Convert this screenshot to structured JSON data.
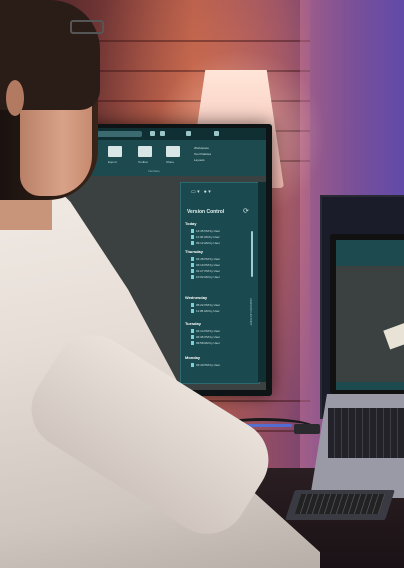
{
  "scene": {
    "description_tag": "photo-of-developer-at-desk"
  },
  "monitor_app": {
    "ribbon": {
      "button_labels": [
        "Ribbon",
        "Export",
        "Toolbar",
        "Share"
      ],
      "group_label": "Interface",
      "list_items": [
        "Workspace",
        "Tool Palettes",
        "Layouts"
      ]
    },
    "version_control": {
      "title": "Version Control",
      "side_label": "VERSION HISTORY",
      "days": [
        {
          "label": "Today",
          "items": [
            "12:45 PM by User",
            "11:30 AM by User",
            "09:12 AM by User"
          ]
        },
        {
          "label": "Thursday",
          "items": [
            "04:48 PM by User",
            "03:10 PM by User",
            "01:27 PM by User",
            "10:02 AM by User"
          ]
        },
        {
          "label": "Wednesday",
          "items": [
            "05:22 PM by User",
            "11:05 AM by User"
          ]
        },
        {
          "label": "Tuesday",
          "items": [
            "04:14 PM by User",
            "02:36 PM by User",
            "09:58 AM by User"
          ]
        },
        {
          "label": "Monday",
          "items": [
            "03:40 PM by User"
          ]
        }
      ]
    }
  },
  "colors": {
    "app_teal": "#1d4a4f",
    "panel_teal": "#1a4a4f",
    "canvas_gray": "#3a4140",
    "shirt": "#ece4dd"
  }
}
